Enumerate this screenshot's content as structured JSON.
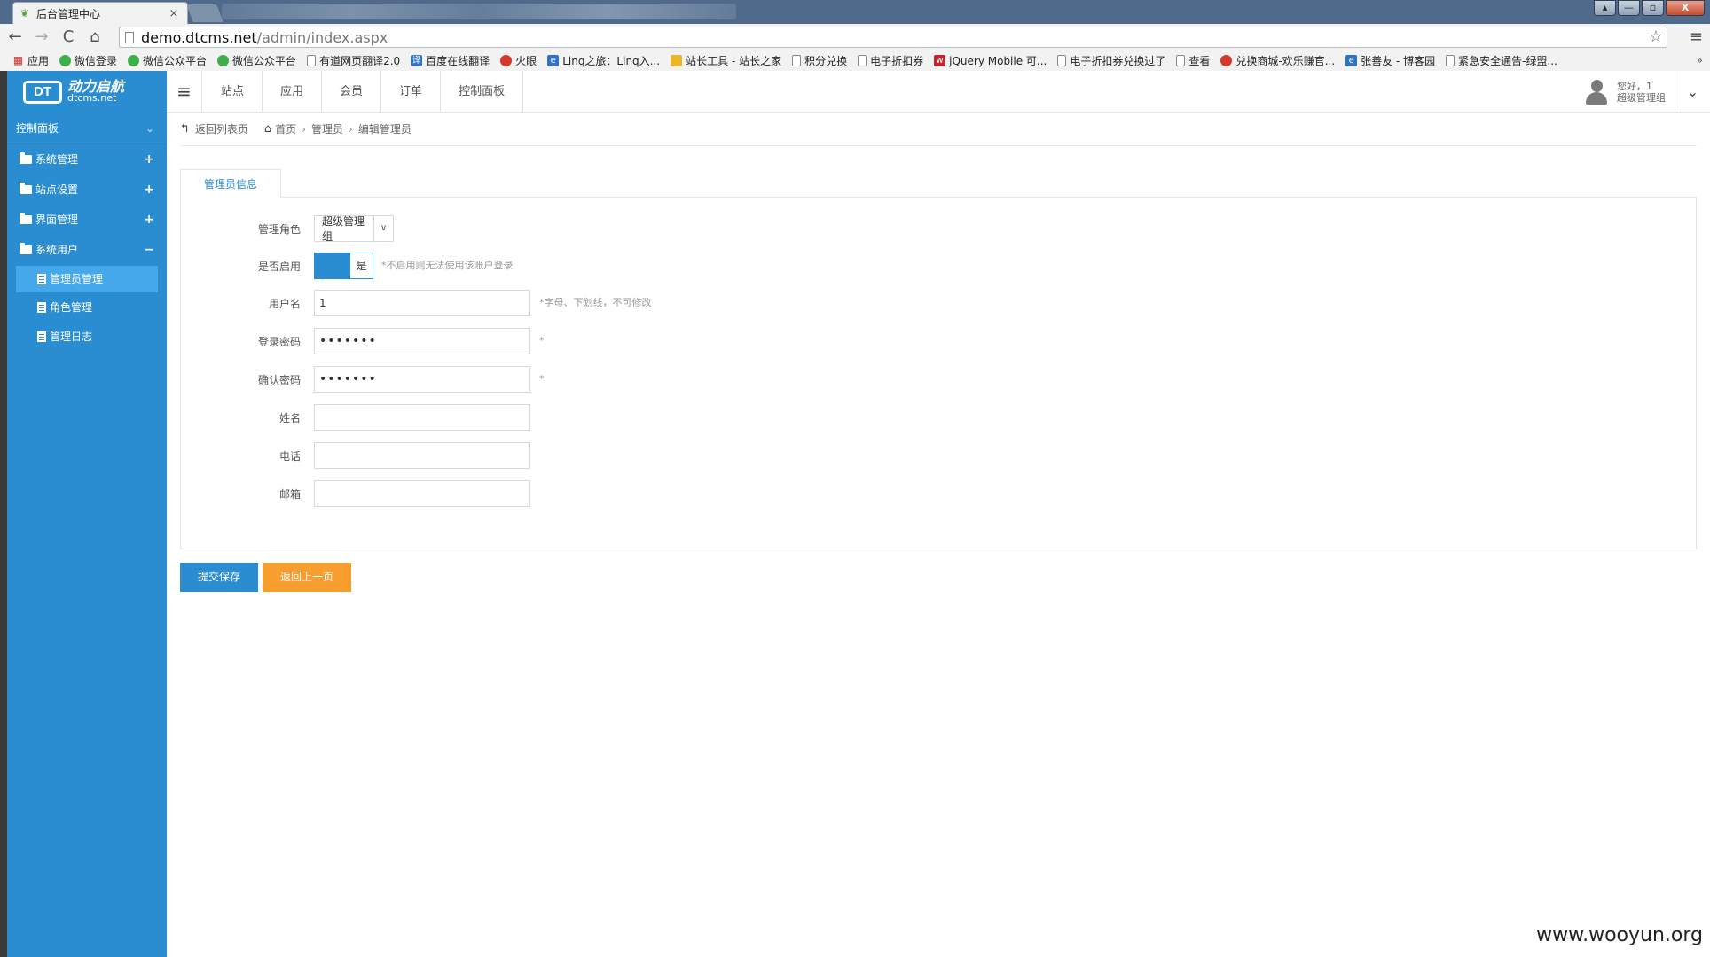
{
  "browser": {
    "tab_title": "后台管理中心",
    "tab_close": "×",
    "url_host": "demo.dtcms.net",
    "url_path": "/admin/index.aspx",
    "nav": {
      "back": "←",
      "forward": "→",
      "reload": "C",
      "home": "⌂"
    },
    "star": "☆",
    "menu": "≡",
    "window_controls": [
      "▴",
      "—",
      "▫",
      "X"
    ],
    "bookmarks": [
      {
        "label": "应用",
        "icon": "apps-icon"
      },
      {
        "label": "微信登录",
        "icon": "wechat-icon"
      },
      {
        "label": "微信公众平台",
        "icon": "wechat-icon"
      },
      {
        "label": "微信公众平台",
        "icon": "wechat-icon"
      },
      {
        "label": "有道网页翻译2.0",
        "icon": "page-icon"
      },
      {
        "label": "百度在线翻译",
        "icon": "baidu-translate-icon"
      },
      {
        "label": "火眼",
        "icon": "fire-eye-icon"
      },
      {
        "label": "Linq之旅：Linq入...",
        "icon": "ie-icon"
      },
      {
        "label": "站长工具 - 站长之家",
        "icon": "chinaz-icon"
      },
      {
        "label": "积分兑换",
        "icon": "page-icon"
      },
      {
        "label": "电子折扣券",
        "icon": "page-icon"
      },
      {
        "label": "jQuery Mobile 可...",
        "icon": "w3-icon"
      },
      {
        "label": "电子折扣券兑换过了",
        "icon": "page-icon"
      },
      {
        "label": "查看",
        "icon": "page-icon"
      },
      {
        "label": "兑换商城-欢乐赚官...",
        "icon": "exchange-icon"
      },
      {
        "label": "张善友 - 博客园",
        "icon": "ie-icon"
      },
      {
        "label": "紧急安全通告-绿盟...",
        "icon": "page-icon"
      }
    ],
    "bookmarks_more": "»"
  },
  "header": {
    "logo_mark": "DT",
    "logo_cn": "动力启航",
    "logo_en": "dtcms.net",
    "menu_toggle": "≡",
    "nav": [
      "站点",
      "应用",
      "会员",
      "订单",
      "控制面板"
    ],
    "greeting": "您好，1",
    "role": "超级管理组",
    "dropdown": "⌄"
  },
  "sidebar": {
    "title": "控制面板",
    "title_chevron": "⌄",
    "groups": [
      {
        "label": "系统管理",
        "toggle": "+"
      },
      {
        "label": "站点设置",
        "toggle": "+"
      },
      {
        "label": "界面管理",
        "toggle": "+"
      },
      {
        "label": "系统用户",
        "toggle": "−"
      }
    ],
    "items": [
      "管理员管理",
      "角色管理",
      "管理日志"
    ]
  },
  "breadcrumb": {
    "back": "返回列表页",
    "home": "首页",
    "level1": "管理员",
    "level2": "编辑管理员",
    "sep": "›"
  },
  "tabs": [
    "管理员信息"
  ],
  "form": {
    "role": {
      "label": "管理角色",
      "value": "超级管理组",
      "arrow": "∨"
    },
    "enabled": {
      "label": "是否启用",
      "value": "是",
      "tip": "*不启用则无法使用该账户登录"
    },
    "username": {
      "label": "用户名",
      "value": "1",
      "tip": "*字母、下划线，不可修改"
    },
    "password": {
      "label": "登录密码",
      "value": "•••••••",
      "tip": "*"
    },
    "confirm": {
      "label": "确认密码",
      "value": "•••••••",
      "tip": "*"
    },
    "realname": {
      "label": "姓名",
      "value": ""
    },
    "phone": {
      "label": "电话",
      "value": ""
    },
    "email": {
      "label": "邮箱",
      "value": ""
    }
  },
  "buttons": {
    "submit": "提交保存",
    "back": "返回上一页"
  },
  "watermark": "www.wooyun.org",
  "colors": {
    "primary": "#2a8dd1",
    "warning": "#f79e2f"
  }
}
